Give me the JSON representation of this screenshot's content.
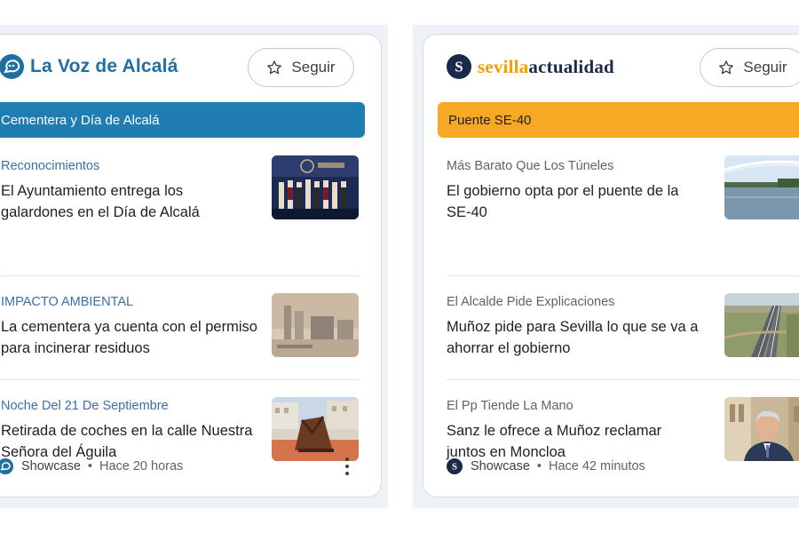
{
  "colors": {
    "backdrop": "#eef1f6",
    "left_accent": "#1f7db2",
    "left_logo": "#1f6fa3",
    "right_topic": "#f9a825",
    "right_logo_dark": "#1b2a4a",
    "right_logo_orange": "#f0a000",
    "kicker_blue": "#3c6fa8",
    "kicker_gray": "#5f6368"
  },
  "left_card": {
    "logo_icon": "speech-bubble-logo-icon",
    "publication": "La Voz de Alcalá",
    "follow_label": "Seguir",
    "topic": "Cementera y Día de Alcalá",
    "stories": [
      {
        "kicker": "Reconocimientos",
        "headline": "El Ayuntamiento entrega los galardones en el Día de Alcalá",
        "thumb": "award-ceremony-photo"
      },
      {
        "kicker": "IMPACTO AMBIENTAL",
        "headline": "La cementera ya cuenta con el permiso para incinerar residuos",
        "thumb": "cement-factory-photo"
      },
      {
        "kicker": "Noche Del 21 De Septiembre",
        "headline": "Retirada de coches en la calle Nuestra Señora del Águila",
        "thumb": "street-sculpture-photo"
      }
    ],
    "footer": {
      "label": "Showcase",
      "separator": "•",
      "time": "Hace 20 horas"
    }
  },
  "right_card": {
    "logo_icon": "s-circle-logo-icon",
    "publication_part1": "sevilla",
    "publication_part2": "actualidad",
    "follow_label": "Seguir",
    "topic": "Puente SE-40",
    "stories": [
      {
        "kicker": "Más Barato Que Los Túneles",
        "headline": "El gobierno opta por el puente de la SE-40",
        "thumb": "bridge-over-river-photo"
      },
      {
        "kicker": "El Alcalde Pide Explicaciones",
        "headline": "Muñoz pide para Sevilla lo que se va a ahorrar el gobierno",
        "thumb": "highway-aerial-photo"
      },
      {
        "kicker": "El Pp Tiende La Mano",
        "headline": "Sanz le ofrece a Muñoz reclamar juntos en Moncloa",
        "thumb": "politician-portrait-photo"
      }
    ],
    "footer": {
      "label": "Showcase",
      "separator": "•",
      "time": "Hace 42 minutos"
    }
  }
}
